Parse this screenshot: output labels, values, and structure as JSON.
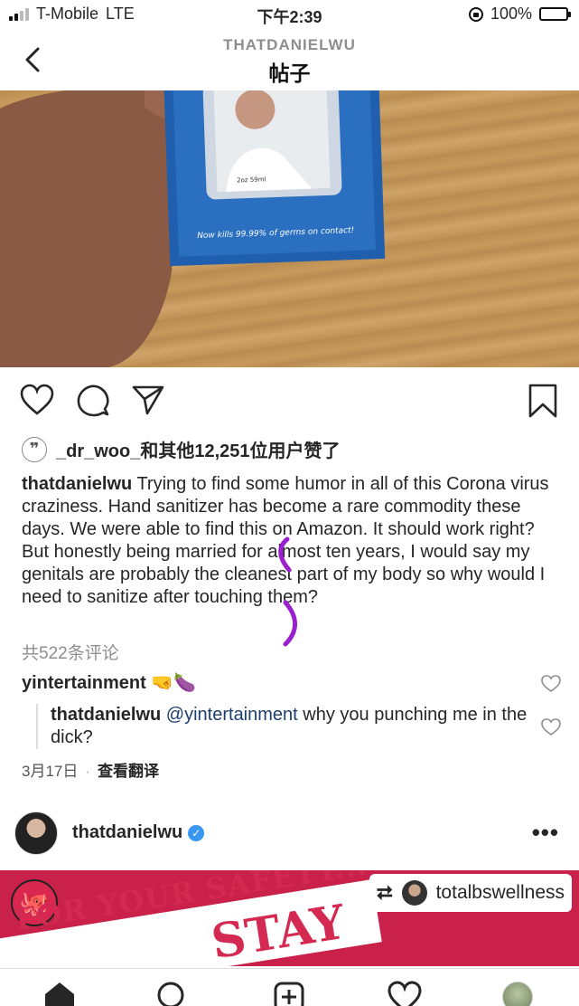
{
  "status_bar": {
    "carrier": "T-Mobile",
    "network": "LTE",
    "time": "下午2:39",
    "battery": "100%"
  },
  "header": {
    "username": "THATDANIELWU",
    "title": "帖子"
  },
  "photo": {
    "product_text": "Now kills 99.99% of germs on contact!",
    "size_text": "2oz 59ml"
  },
  "likes": {
    "text": "_dr_woo_和其他12,251位用户赞了"
  },
  "caption": {
    "username": "thatdanielwu",
    "text": "Trying to find some humor in all of this Corona virus craziness. Hand sanitizer has become a rare commodity these days. We were able to find this on Amazon. It should work right? But honestly being married for almost ten years, I would say my genitals are probably the cleanest part of my body so why would I need to sanitize after touching them?"
  },
  "view_comments": "共522条评论",
  "comment": {
    "username": "yintertainment",
    "text": "🤜🍆"
  },
  "reply": {
    "username": "thatdanielwu",
    "mention": "@yintertainment",
    "text": "why you punching me in the dick?"
  },
  "meta": {
    "date": "3月17日",
    "translate": "查看翻译"
  },
  "next_post": {
    "username": "thatdanielwu",
    "repost_user": "totalbswellness",
    "banner_line1": "FOR YOUR SAFETY...",
    "banner_line2": "STAY"
  },
  "colors": {
    "link": "#1b3e6f",
    "verified": "#3897f0",
    "banner": "#c9214a"
  }
}
